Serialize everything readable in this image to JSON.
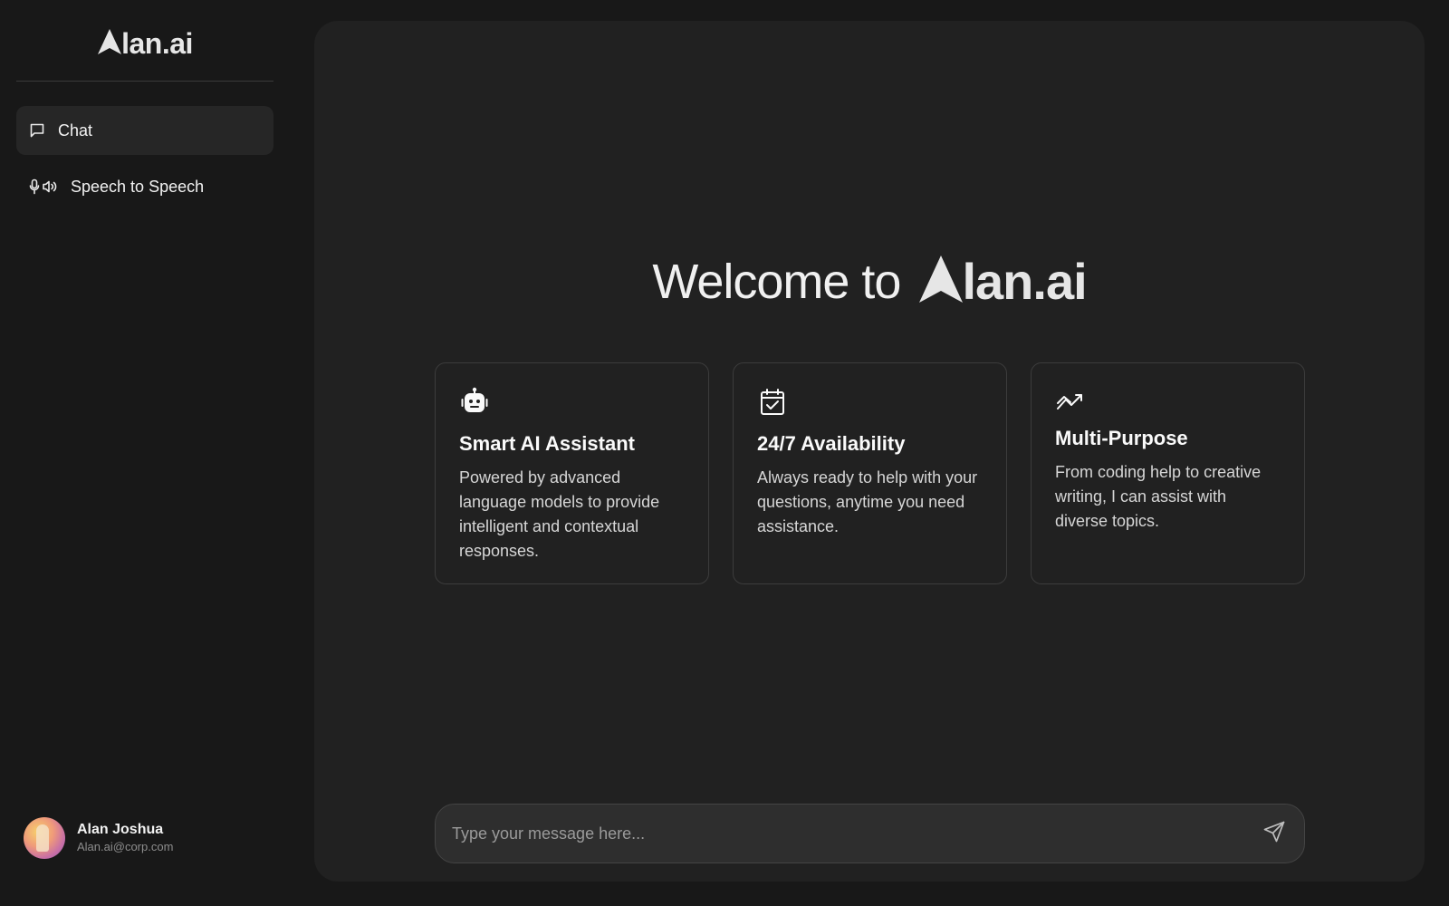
{
  "brand": {
    "name": "lan.ai",
    "logo_icon": "triangle-a-logo-icon"
  },
  "sidebar": {
    "items": [
      {
        "label": "Chat",
        "icon": "chat-bubble-icon",
        "active": true
      },
      {
        "label": "Speech to Speech",
        "icon": "microphone-speaker-icon",
        "active": false
      }
    ]
  },
  "user": {
    "name": "Alan Joshua",
    "email": "Alan.ai@corp.com"
  },
  "main": {
    "welcome_prefix": "Welcome to",
    "welcome_brand": "lan.ai",
    "cards": [
      {
        "icon": "robot-icon",
        "title": "Smart AI Assistant",
        "description": "Powered by advanced language models to provide intelligent and contextual responses."
      },
      {
        "icon": "calendar-check-icon",
        "title": "24/7 Availability",
        "description": "Always ready to help with your questions, anytime you need assistance."
      },
      {
        "icon": "trend-arrows-icon",
        "title": "Multi-Purpose",
        "description": "From coding help to creative writing, I can assist with diverse topics."
      }
    ]
  },
  "composer": {
    "placeholder": "Type your message here...",
    "value": "",
    "send_icon": "send-icon"
  },
  "colors": {
    "background": "#181818",
    "panel": "#212121",
    "active_nav": "#262626",
    "card_border": "#3c3c3c",
    "input_bg": "#2e2e2e"
  }
}
